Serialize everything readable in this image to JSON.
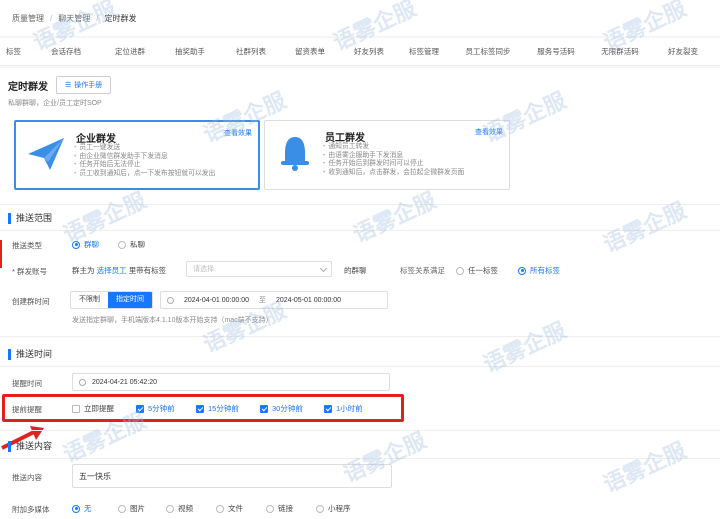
{
  "breadcrumb": {
    "items": [
      "质量管理",
      "聊天管理",
      "定时群发"
    ]
  },
  "tabs": [
    "标签",
    "会话存档",
    "定位进群",
    "抽奖助手",
    "社群列表",
    "留资表单",
    "好友列表",
    "标签管理",
    "员工标签同步",
    "服务号活码",
    "无限群活码",
    "好友裂变"
  ],
  "page": {
    "title": "定时群发",
    "manual_button": "操作手册",
    "subtitle": "私聊群聊，企业/员工定时SOP"
  },
  "type_cards": [
    {
      "title": "企业群发",
      "link": "查看效果",
      "selected": true,
      "items": [
        "员工一键发送",
        "由企业微信群发助手下发消息",
        "任务开始后无法停止",
        "员工收到通知后，点一下发布按钮就可以发出"
      ]
    },
    {
      "title": "员工群发",
      "link": "查看效果",
      "selected": false,
      "items": [
        "通知员工转发",
        "由语雾企服助手下发消息",
        "任务开始后到群发时间可以停止",
        "收到通知后，点击群发，会拉起企微群发页面"
      ]
    }
  ],
  "scope": {
    "heading": "推送范围",
    "push_type_label": "推送类型",
    "push_type_options": [
      "群聊",
      "私聊"
    ],
    "sender_label": "* 群发账号",
    "sender_prefix": "群主为",
    "sender_select_link": "选择员工",
    "sender_middle": "里带有标签",
    "tag_placeholder": "请选择",
    "group_chat_suffix": "的群聊",
    "tag_relation_label": "标签关系满足",
    "tag_relation_options": [
      "任一标签",
      "所有标签"
    ],
    "created_label": "创建群时间",
    "created_options": [
      "不限制",
      "指定时间"
    ],
    "start_date": "2024-04-01 00:00:00",
    "to_label": "至",
    "end_date": "2024-05-01 00:00:00",
    "hint": "发送指定群聊，手机端版本4.1.10版本开始支持（mac端不支持）"
  },
  "time": {
    "heading": "推送时间",
    "remind_label": "提醒时间",
    "remind_value": "2024-04-21 05:42:20",
    "advance_label": "提前提醒",
    "advance_options": [
      {
        "label": "立即提醒",
        "checked": false
      },
      {
        "label": "5分钟前",
        "checked": true
      },
      {
        "label": "15分钟前",
        "checked": true
      },
      {
        "label": "30分钟前",
        "checked": true
      },
      {
        "label": "1小时前",
        "checked": true
      }
    ]
  },
  "content": {
    "heading": "推送内容",
    "content_label": "推送内容",
    "content_value": "五一快乐",
    "media_label": "附加多媒体",
    "media_options": [
      "无",
      "图片",
      "视频",
      "文件",
      "链接",
      "小程序"
    ]
  },
  "watermark": "语雾企服",
  "colors": {
    "accent": "#1677ff",
    "highlight": "#e0221f"
  }
}
